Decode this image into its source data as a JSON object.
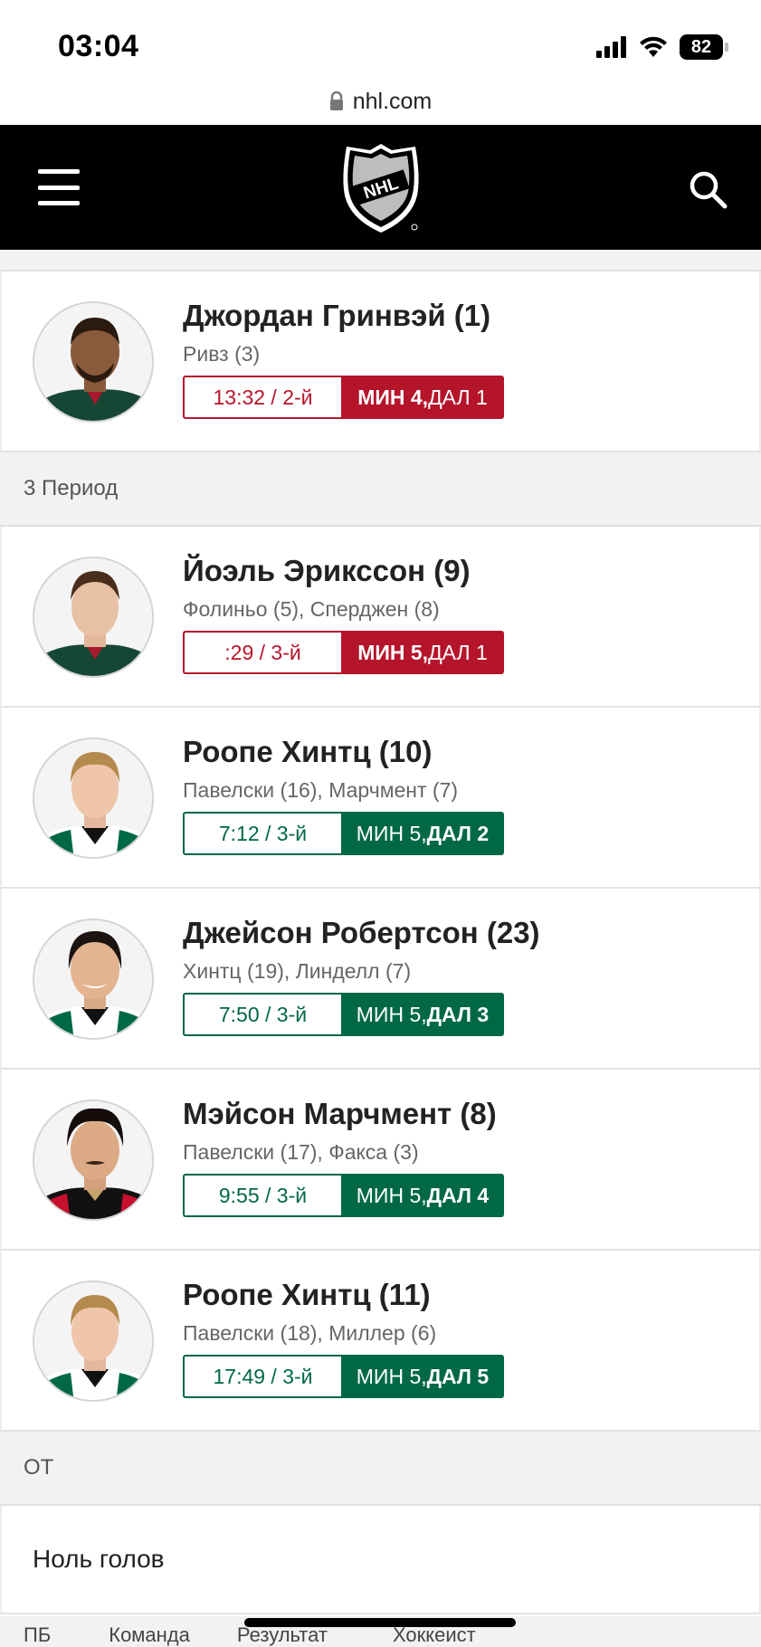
{
  "status_bar": {
    "time": "03:04",
    "battery": "82"
  },
  "url_bar": {
    "domain": "nhl.com"
  },
  "header": {
    "logo_text": "NHL"
  },
  "goals_top": [
    {
      "scorer": "Джордан Гринвэй (1)",
      "assists": "Ривз (3)",
      "time": "13:32 / 2-й",
      "score_min": "МИН 4,",
      "score_dal": " ДАЛ 1",
      "scoring_team": "МИН",
      "team_color": "#b5152b"
    }
  ],
  "period3": {
    "label": "3 Период",
    "goals": [
      {
        "scorer": "Йоэль Эрикссон (9)",
        "assists": "Фолиньо (5), Сперджен (8)",
        "time": ":29 / 3-й",
        "score_min": "МИН 5,",
        "score_dal": " ДАЛ 1",
        "scoring_team": "МИН",
        "team_color": "#b5152b"
      },
      {
        "scorer": "Роопе Хинтц (10)",
        "assists": "Павелски (16), Марчмент (7)",
        "time": "7:12 / 3-й",
        "score_min": "МИН 5,",
        "score_dal": " ДАЛ 2",
        "scoring_team": "ДАЛ",
        "team_color": "#006847"
      },
      {
        "scorer": "Джейсон Робертсон (23)",
        "assists": "Хинтц (19), Линделл (7)",
        "time": "7:50 / 3-й",
        "score_min": "МИН 5,",
        "score_dal": " ДАЛ 3",
        "scoring_team": "ДАЛ",
        "team_color": "#006847"
      },
      {
        "scorer": "Мэйсон Марчмент (8)",
        "assists": "Павелски (17), Факса (3)",
        "time": "9:55 / 3-й",
        "score_min": "МИН 5,",
        "score_dal": " ДАЛ 4",
        "scoring_team": "ДАЛ",
        "team_color": "#006847"
      },
      {
        "scorer": "Роопе Хинтц (11)",
        "assists": "Павелски (18), Миллер (6)",
        "time": "17:49 / 3-й",
        "score_min": "МИН 5,",
        "score_dal": " ДАЛ 5",
        "scoring_team": "ДАЛ",
        "team_color": "#006847"
      }
    ]
  },
  "overtime": {
    "label": "ОТ",
    "no_goals": "Ноль голов"
  },
  "footer_tabs": [
    "ПБ",
    "Команда",
    "Результат",
    "Хоккеист"
  ]
}
